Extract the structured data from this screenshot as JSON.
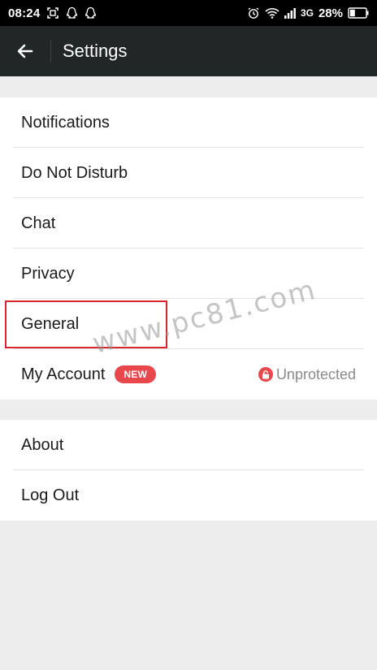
{
  "status_bar": {
    "time": "08:24",
    "network": "3G",
    "battery": "28%",
    "left_icons": [
      "screenshot-icon",
      "qq-icon",
      "qq-icon"
    ],
    "right_icons": [
      "alarm-icon",
      "wifi-icon",
      "signal-icon",
      "battery-icon"
    ]
  },
  "app_bar": {
    "title": "Settings",
    "back_icon": "arrow-left-icon"
  },
  "groups": [
    {
      "items": [
        {
          "label": "Notifications"
        },
        {
          "label": "Do Not Disturb"
        },
        {
          "label": "Chat"
        },
        {
          "label": "Privacy"
        },
        {
          "label": "General"
        },
        {
          "label": "My Account",
          "badge": "NEW",
          "status": "Unprotected",
          "status_icon": "lock-icon"
        }
      ]
    },
    {
      "items": [
        {
          "label": "About"
        },
        {
          "label": "Log Out"
        }
      ]
    }
  ],
  "watermark": "www.pc81.com",
  "colors": {
    "app_bar": "#232627",
    "accent_red": "#e8474c",
    "highlight": "#d8262b",
    "background": "#ededed"
  }
}
